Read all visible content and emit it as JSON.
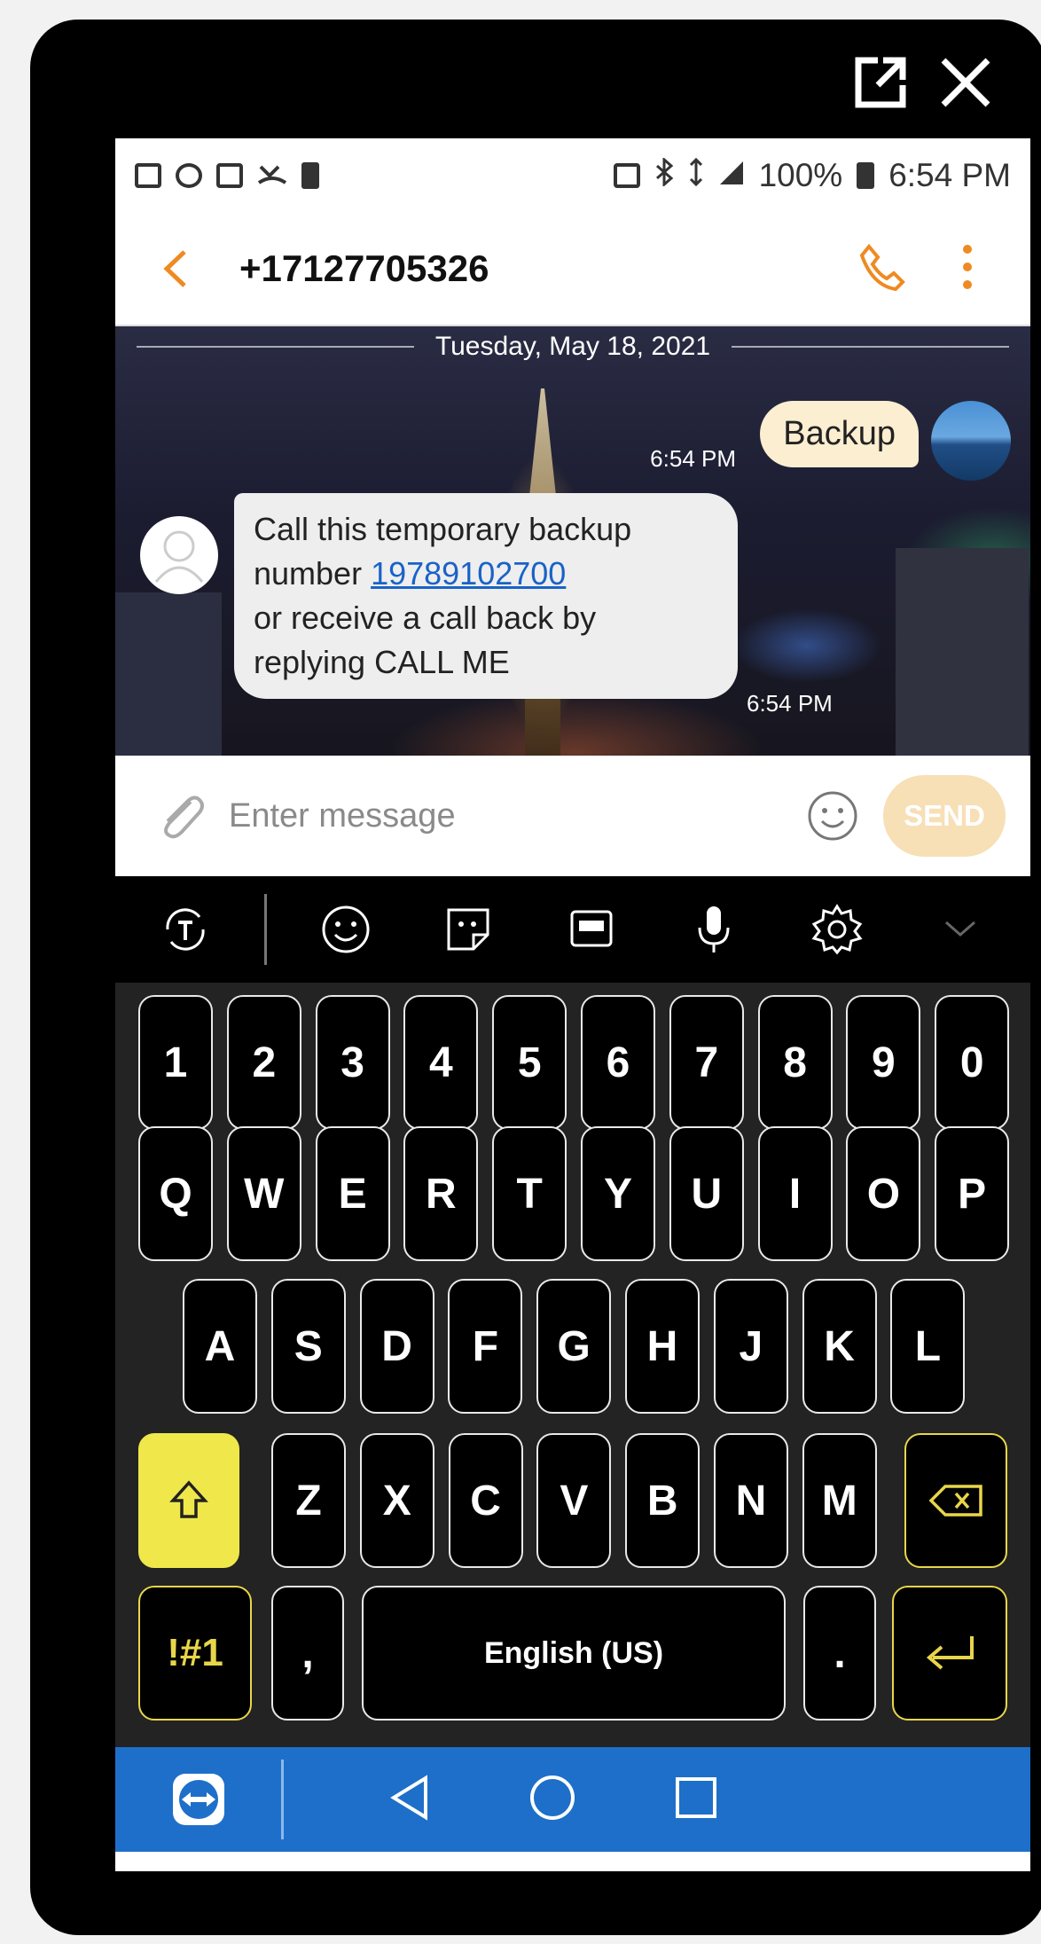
{
  "window": {
    "popout_icon": "popout-icon",
    "close_icon": "close-icon"
  },
  "status_bar": {
    "battery": "100%",
    "time": "6:54 PM"
  },
  "header": {
    "contact": "+17127705326"
  },
  "conversation": {
    "date": "Tuesday, May 18, 2021",
    "messages": [
      {
        "direction": "outgoing",
        "text": "Backup",
        "time": "6:54 PM"
      },
      {
        "direction": "incoming",
        "line1": "Call this temporary backup",
        "line2_prefix": "number ",
        "link": "19789102700",
        "line3": "or receive a call back by",
        "line4": "replying CALL ME",
        "time": "6:54 PM"
      }
    ]
  },
  "compose": {
    "placeholder": "Enter message",
    "send_label": "SEND"
  },
  "keyboard": {
    "row_numbers": [
      "1",
      "2",
      "3",
      "4",
      "5",
      "6",
      "7",
      "8",
      "9",
      "0"
    ],
    "row_top": [
      "Q",
      "W",
      "E",
      "R",
      "T",
      "Y",
      "U",
      "I",
      "O",
      "P"
    ],
    "row_middle": [
      "A",
      "S",
      "D",
      "F",
      "G",
      "H",
      "J",
      "K",
      "L"
    ],
    "row_bottom": [
      "Z",
      "X",
      "C",
      "V",
      "B",
      "N",
      "M"
    ],
    "symbols_label": "!#1",
    "comma_label": ",",
    "space_label": "English (US)",
    "period_label": "."
  },
  "colors": {
    "accent_orange": "#ef8a22",
    "send_disabled": "#f7dfb6",
    "link_blue": "#1a62c7",
    "key_yellow": "#e8d64a",
    "navbar_blue": "#1e6fc9"
  }
}
